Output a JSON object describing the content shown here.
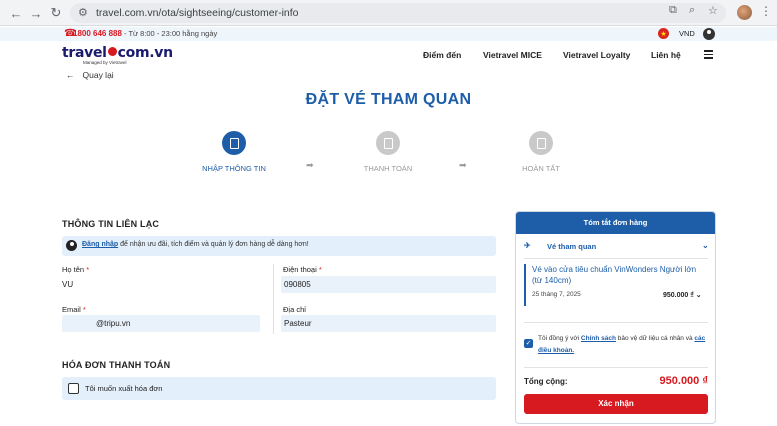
{
  "browser": {
    "url": "travel.com.vn/ota/sightseeing/customer-info"
  },
  "topbar": {
    "hotline": "1800 646 888",
    "hours": "- Từ 8:00 - 23:00 hằng ngày",
    "currency": "VND"
  },
  "header": {
    "logo_left": "travel",
    "logo_right": "com.vn",
    "logo_sub": "Managed by Vietravel",
    "nav": [
      "Điểm đến",
      "Vietravel MICE",
      "Vietravel Loyalty",
      "Liên hệ"
    ]
  },
  "back_label": "Quay lại",
  "page_title": "ĐẶT VÉ THAM QUAN",
  "steps": [
    {
      "label": "NHẬP THÔNG TIN",
      "state": "active"
    },
    {
      "label": "THANH TOÁN",
      "state": "inactive"
    },
    {
      "label": "HOÀN TẤT",
      "state": "inactive"
    }
  ],
  "contact": {
    "section_title": "THÔNG TIN LIÊN LẠC",
    "login_link": "Đăng nhập",
    "login_text": " để nhận ưu đãi, tích điểm và quản lý đơn hàng dễ dàng hơn!",
    "name_label": "Họ tên",
    "name_value": "VU",
    "phone_label": "Điện thoại",
    "phone_value": "090805",
    "email_label": "Email",
    "email_value": "@tripu.vn",
    "address_label": "Địa chỉ",
    "address_value": "Pasteur"
  },
  "invoice": {
    "section_title": "HÓA ĐƠN THANH TOÁN",
    "checkbox_label": "Tôi muốn xuất hóa đơn"
  },
  "summary": {
    "title": "Tóm tắt đơn hàng",
    "item_group": "Vé tham quan",
    "ticket_name": "Vé vào cửa tiêu chuẩn VinWonders Người lớn (từ 140cm)",
    "ticket_date": "25 tháng 7, 2025",
    "ticket_price": "950.000 ₫",
    "agree_prefix": "Tôi đồng ý với ",
    "agree_link1": "Chính sách",
    "agree_middle": " bảo vệ dữ liệu cá nhân và ",
    "agree_link2": "các điều khoản.",
    "total_label": "Tổng cộng:",
    "total_value": "950.000 ₫",
    "confirm_label": "Xác nhận"
  },
  "colors": {
    "primary": "#1e5ea8",
    "accent_red": "#d71920",
    "field_bg": "#e9f2fb"
  }
}
